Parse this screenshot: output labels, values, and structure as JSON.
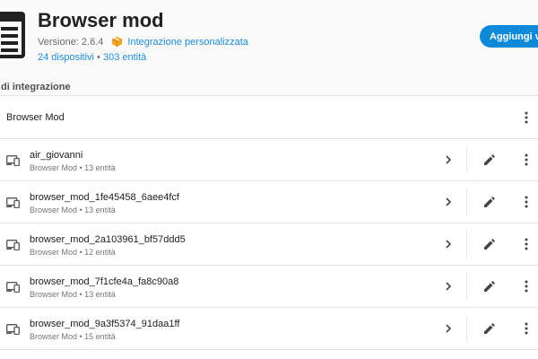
{
  "header": {
    "title": "Browser mod",
    "version": "Versione: 2.6.4",
    "custom_integration": "Integrazione personalizzata",
    "devices_link": "24 dispositivi",
    "separator": "•",
    "entities_link": "303 entità",
    "add_button_label": "Aggiungi voce"
  },
  "section": {
    "label": "di integrazione"
  },
  "entry": {
    "title": "Browser Mod"
  },
  "devices": [
    {
      "name": "air_giovanni",
      "subtitle": "Browser Mod • 13 entità"
    },
    {
      "name": "browser_mod_1fe45458_6aee4fcf",
      "subtitle": "Browser Mod • 13 entità"
    },
    {
      "name": "browser_mod_2a103961_bf57ddd5",
      "subtitle": "Browser Mod • 12 entità"
    },
    {
      "name": "browser_mod_7f1cfe4a_fa8c90a8",
      "subtitle": "Browser Mod • 13 entità"
    },
    {
      "name": "browser_mod_9a3f5374_91daa1ff",
      "subtitle": "Browser Mod • 15 entità"
    }
  ],
  "colors": {
    "accent": "#0e8ad9",
    "link": "#1d8bd6",
    "package_icon": "#f5a623"
  },
  "icons": {
    "logo": "browser-mod-logo",
    "package": "package-icon",
    "device": "devices-icon",
    "chevron": "chevron-right-icon",
    "edit": "pencil-icon",
    "menu": "kebab-menu-icon"
  }
}
